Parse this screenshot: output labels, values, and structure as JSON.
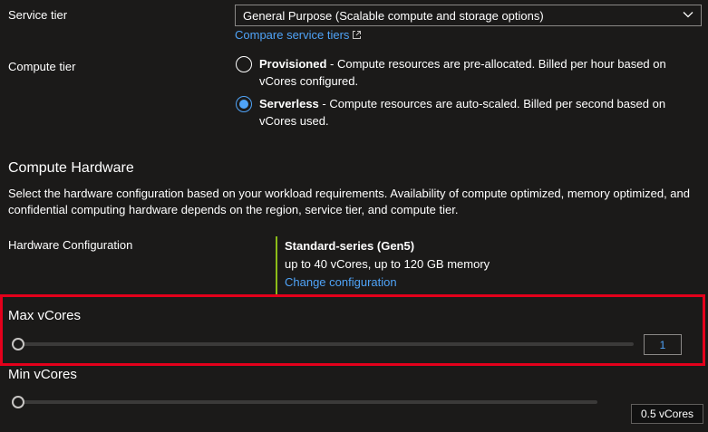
{
  "service_tier": {
    "label": "Service tier",
    "selected": "General Purpose (Scalable compute and storage options)",
    "compare_link": "Compare service tiers"
  },
  "compute_tier": {
    "label": "Compute tier",
    "options": [
      {
        "name": "Provisioned",
        "description": " - Compute resources are pre-allocated. Billed per hour based on",
        "description_line2": "vCores configured.",
        "checked": false
      },
      {
        "name": "Serverless",
        "description": " - Compute resources are auto-scaled. Billed per second based on",
        "description_line2": "vCores used.",
        "checked": true
      }
    ]
  },
  "compute_hardware": {
    "title": "Compute Hardware",
    "description_line1": "Select the hardware configuration based on your workload requirements. Availability of compute optimized, memory optimized, and",
    "description_line2": "confidential computing hardware depends on the region, service tier, and compute tier.",
    "hw_label": "Hardware Configuration",
    "hw_name": "Standard-series (Gen5)",
    "hw_specs": "up to 40 vCores, up to 120 GB memory",
    "change_link": "Change configuration"
  },
  "max_vcores": {
    "label": "Max vCores",
    "value": "1"
  },
  "min_vcores": {
    "label": "Min vCores",
    "value": "0.5 vCores"
  },
  "colors": {
    "accent": "#4fa3f7",
    "highlight": "#e3001b",
    "hw_bar": "#8cbd18",
    "background": "#1b1a19"
  }
}
